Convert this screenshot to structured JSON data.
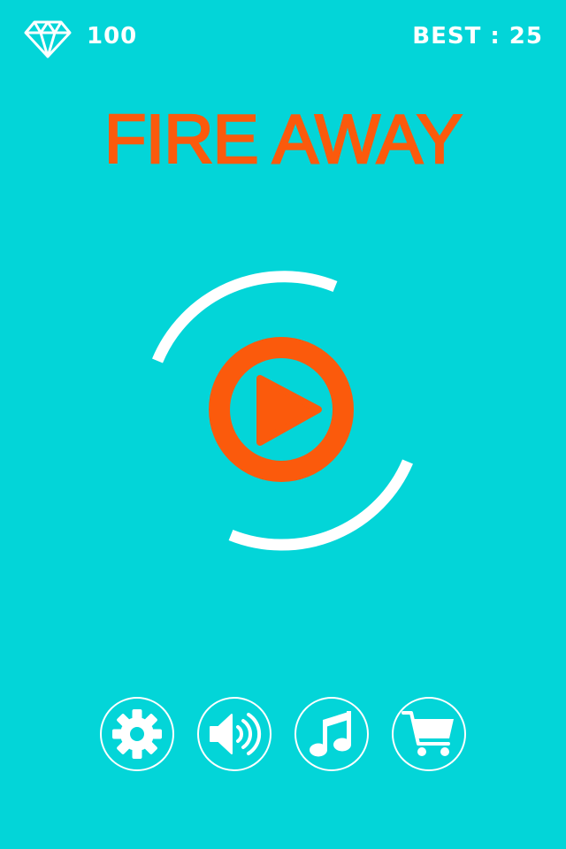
{
  "header": {
    "gem_icon": "diamond-icon",
    "gem_count": "100",
    "best_label": "BEST : 25"
  },
  "title": "FIRE AWAY",
  "play": {
    "icon": "play-icon"
  },
  "menu": [
    {
      "icon": "gear-icon",
      "name": "settings"
    },
    {
      "icon": "speaker-icon",
      "name": "sound"
    },
    {
      "icon": "music-note-icon",
      "name": "music"
    },
    {
      "icon": "cart-icon",
      "name": "shop"
    }
  ],
  "colors": {
    "background": "#03d5d8",
    "accent": "#fb5a0c",
    "foreground": "#ffffff"
  }
}
